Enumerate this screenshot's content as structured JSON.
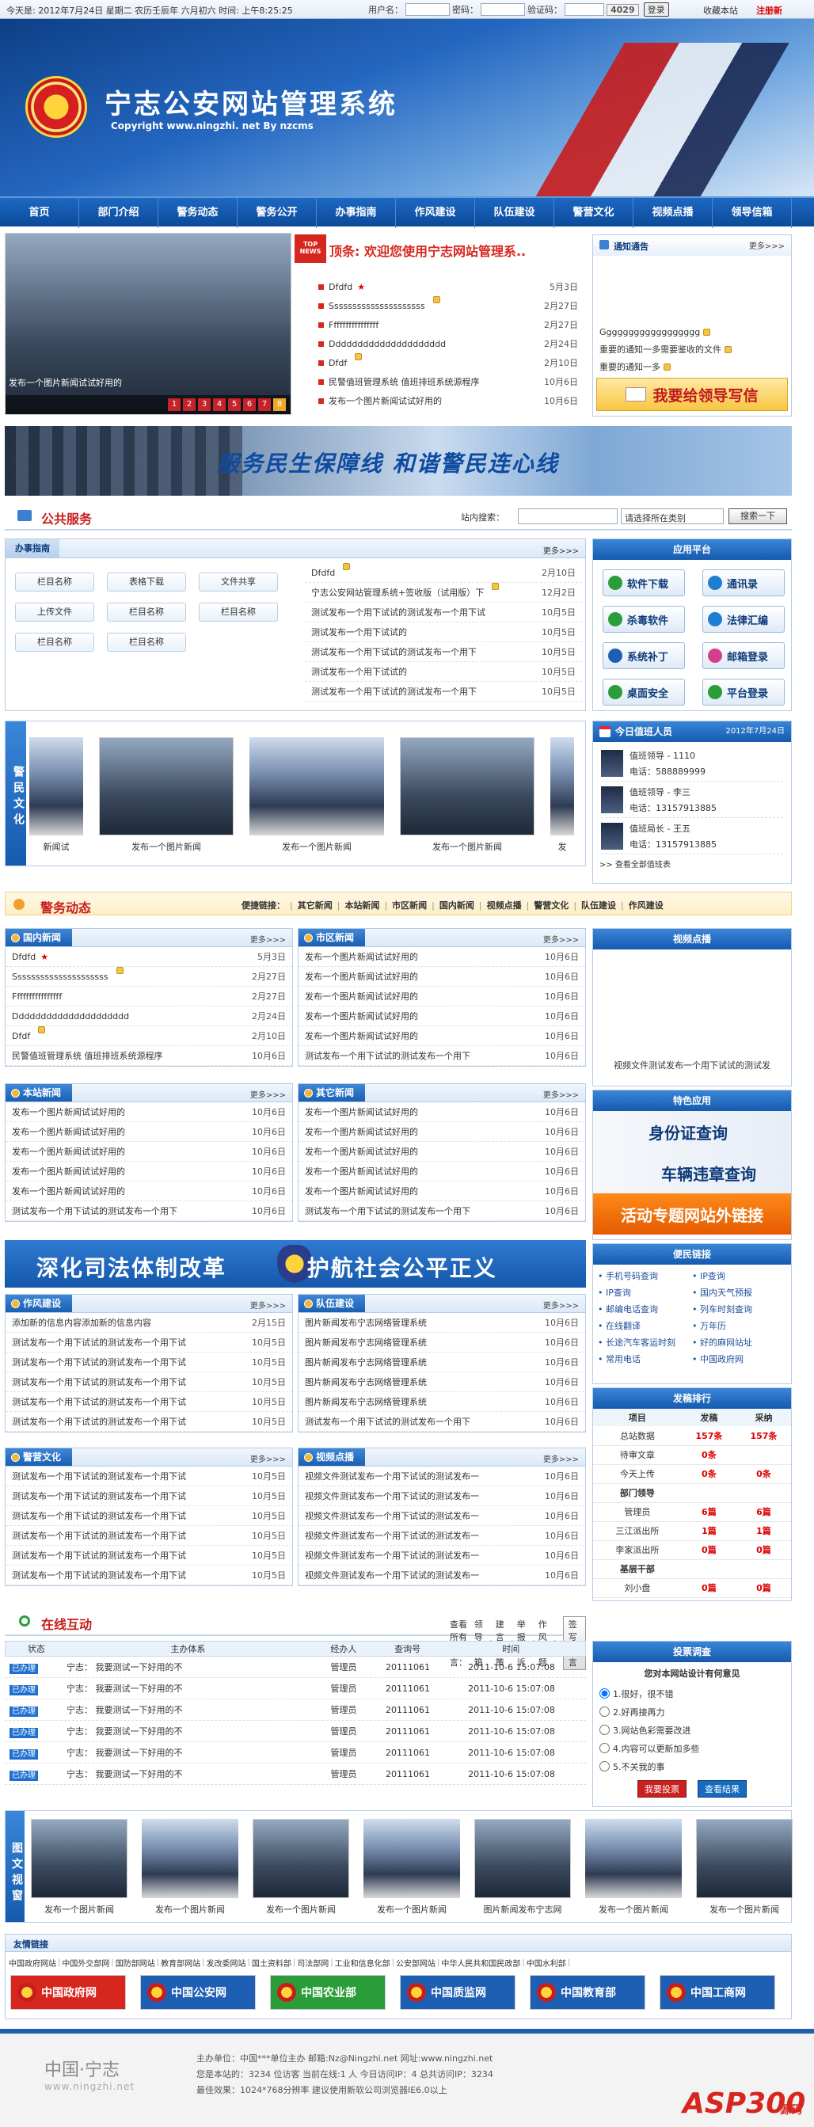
{
  "topbar": {
    "calendar": "今天是: 2012年7月24日 星期二  农历壬辰年 六月初六 时间: 上午8:25:25",
    "user_label": "用户名：",
    "pass_label": "密码：",
    "code_label": "验证码：",
    "code": "4029",
    "login_btn": "登录",
    "fav": "收藏本站",
    "reg": "注册新"
  },
  "header": {
    "title": "宁志公安网站管理系统",
    "copyright": "Copyright  www.ningzhi. net By nzcms"
  },
  "nav": [
    "首页",
    "部门介绍",
    "警务动态",
    "警务公开",
    "办事指南",
    "作风建设",
    "队伍建设",
    "警营文化",
    "视频点播",
    "领导信箱"
  ],
  "slideshow": {
    "caption": "发布一个图片新闻试试好用的",
    "pages": [
      "1",
      "2",
      "3",
      "4",
      "5",
      "6",
      "7",
      "8"
    ]
  },
  "headline": {
    "badge": "TOP NEWS",
    "title": "顶条: 欢迎您使用宁志网站管理系..",
    "items": [
      {
        "t": "Dfdfd",
        "star": true,
        "d": "5月3日"
      },
      {
        "t": "Sssssssssssssssssssss",
        "lock": true,
        "d": "2月27日"
      },
      {
        "t": "Ffffffffffffffff",
        "d": "2月27日"
      },
      {
        "t": "Ddddddddddddddddddddd",
        "d": "2月24日"
      },
      {
        "t": "Dfdf",
        "lock": true,
        "d": "2月10日"
      },
      {
        "t": "民警值班管理系统 值班排班系统源程序",
        "d": "10月6日"
      },
      {
        "t": "发布一个图片新闻试试好用的",
        "d": "10月6日"
      }
    ]
  },
  "notice": {
    "title": "通知通告",
    "more": "更多>>>",
    "items": [
      {
        "t": "Gggggggggggggggggg",
        "lock": true
      },
      {
        "t": "重要的通知一多需要鉴收的文件",
        "lock": true
      },
      {
        "t": "重要的通知一多",
        "lock": true
      }
    ],
    "write": "我要给领导写信"
  },
  "banner1": "服务民生保障线   和谐警民连心线",
  "public": {
    "title": "公共服务",
    "search_label": "站内搜索：",
    "select": "请选择所在类别",
    "search_btn": "搜索一下",
    "guide_title": "办事指南",
    "guide_more": "更多>>>",
    "buttons": [
      "栏目名称",
      "表格下载",
      "文件共享",
      "上传文件",
      "栏目名称",
      "栏目名称",
      "栏目名称",
      "栏目名称"
    ],
    "items": [
      {
        "t": "Dfdfd",
        "lock": true,
        "d": "2月10日"
      },
      {
        "t": "宁志公安网站管理系统+签收版（试用版）下",
        "lock": true,
        "d": "12月2日"
      },
      {
        "t": "测试发布一个用下试试的测试发布一个用下试",
        "d": "10月5日"
      },
      {
        "t": "测试发布一个用下试试的",
        "d": "10月5日"
      },
      {
        "t": "测试发布一个用下试试的测试发布一个用下",
        "d": "10月5日"
      },
      {
        "t": "测试发布一个用下试试的",
        "d": "10月5日"
      },
      {
        "t": "测试发布一个用下试试的测试发布一个用下",
        "d": "10月5日"
      }
    ]
  },
  "platform": {
    "title": "应用平台",
    "items": [
      "软件下载",
      "通讯录",
      "杀毒软件",
      "法律汇编",
      "系统补丁",
      "邮箱登录",
      "桌面安全",
      "平台登录"
    ]
  },
  "culture": {
    "label": "警民文化",
    "caps": [
      "新闻试",
      "发布一个图片新闻",
      "发布一个图片新闻",
      "发布一个图片新闻",
      "发"
    ]
  },
  "duty": {
    "title": "今日值班人员",
    "date": "2012年7月24日",
    "people": [
      {
        "role": "值班领导 - 1110",
        "tel": "电话：588889999"
      },
      {
        "role": "值班领导 - 李三",
        "tel": "电话：13157913885"
      },
      {
        "role": "值班局长 - 王五",
        "tel": "电话：13157913885"
      }
    ],
    "more": ">> 查看全部值班表"
  },
  "police": {
    "title": "警务动态",
    "quick": "便捷链接：",
    "links": [
      "其它新闻",
      "本站新闻",
      "市区新闻",
      "国内新闻",
      "视频点播",
      "警营文化",
      "队伍建设",
      "作风建设"
    ]
  },
  "domestic": {
    "title": "国内新闻",
    "more": "更多>>>",
    "items": [
      {
        "t": "Dfdfd",
        "star": true,
        "d": "5月3日"
      },
      {
        "t": "Sssssssssssssssssssss",
        "lock": true,
        "d": "2月27日"
      },
      {
        "t": "Ffffffffffffffff",
        "d": "2月27日"
      },
      {
        "t": "Ddddddddddddddddddddd",
        "d": "2月24日"
      },
      {
        "t": "Dfdf",
        "lock": true,
        "d": "2月10日"
      },
      {
        "t": "民警值班管理系统 值班排班系统源程序",
        "d": "10月6日"
      }
    ]
  },
  "city": {
    "title": "市区新闻",
    "more": "更多>>>",
    "items": [
      {
        "t": "发布一个图片新闻试试好用的",
        "d": "10月6日"
      },
      {
        "t": "发布一个图片新闻试试好用的",
        "d": "10月6日"
      },
      {
        "t": "发布一个图片新闻试试好用的",
        "d": "10月6日"
      },
      {
        "t": "发布一个图片新闻试试好用的",
        "d": "10月6日"
      },
      {
        "t": "发布一个图片新闻试试好用的",
        "d": "10月6日"
      },
      {
        "t": "测试发布一个用下试试的测试发布一个用下",
        "d": "10月6日"
      }
    ]
  },
  "site": {
    "title": "本站新闻",
    "more": "更多>>>",
    "items": [
      {
        "t": "发布一个图片新闻试试好用的",
        "d": "10月6日"
      },
      {
        "t": "发布一个图片新闻试试好用的",
        "d": "10月6日"
      },
      {
        "t": "发布一个图片新闻试试好用的",
        "d": "10月6日"
      },
      {
        "t": "发布一个图片新闻试试好用的",
        "d": "10月6日"
      },
      {
        "t": "发布一个图片新闻试试好用的",
        "d": "10月6日"
      },
      {
        "t": "测试发布一个用下试试的测试发布一个用下",
        "d": "10月6日"
      }
    ]
  },
  "other": {
    "title": "其它新闻",
    "more": "更多>>>",
    "items": [
      {
        "t": "发布一个图片新闻试试好用的",
        "d": "10月6日"
      },
      {
        "t": "发布一个图片新闻试试好用的",
        "d": "10月6日"
      },
      {
        "t": "发布一个图片新闻试试好用的",
        "d": "10月6日"
      },
      {
        "t": "发布一个图片新闻试试好用的",
        "d": "10月6日"
      },
      {
        "t": "发布一个图片新闻试试好用的",
        "d": "10月6日"
      },
      {
        "t": "测试发布一个用下试试的测试发布一个用下",
        "d": "10月6日"
      }
    ]
  },
  "video": {
    "title": "视频点播",
    "caption": "视频文件测试发布一个用下试试的测试发"
  },
  "special": {
    "title": "特色应用",
    "id": "身份证查询",
    "car": "车辆违章查询",
    "topic": "活动专题网站外链接"
  },
  "banner2": "深化司法体制改革   护航社会公平正义",
  "service": {
    "title": "便民链接",
    "links": [
      "手机号码查询",
      "IP查询",
      "IP查询",
      "国内天气预报",
      "邮编电话查询",
      "列车时刻查询",
      "在线翻译",
      "万年历",
      "长途汽车客运时刻",
      "好的麻网站址",
      "常用电话",
      "中国政府网"
    ]
  },
  "style": {
    "title": "作风建设",
    "more": "更多>>>",
    "items": [
      {
        "t": "添加新的信息内容添加新的信息内容",
        "d": "2月15日"
      },
      {
        "t": "测试发布一个用下试试的测试发布一个用下试",
        "d": "10月5日"
      },
      {
        "t": "测试发布一个用下试试的测试发布一个用下试",
        "d": "10月5日"
      },
      {
        "t": "测试发布一个用下试试的测试发布一个用下试",
        "d": "10月5日"
      },
      {
        "t": "测试发布一个用下试试的测试发布一个用下试",
        "d": "10月5日"
      },
      {
        "t": "测试发布一个用下试试的测试发布一个用下试",
        "d": "10月5日"
      }
    ]
  },
  "team": {
    "title": "队伍建设",
    "more": "更多>>>",
    "items": [
      {
        "t": "图片新闻发布宁志网络管理系统",
        "d": "10月6日"
      },
      {
        "t": "图片新闻发布宁志网络管理系统",
        "d": "10月6日"
      },
      {
        "t": "图片新闻发布宁志网络管理系统",
        "d": "10月6日"
      },
      {
        "t": "图片新闻发布宁志网络管理系统",
        "d": "10月6日"
      },
      {
        "t": "图片新闻发布宁志网络管理系统",
        "d": "10月6日"
      },
      {
        "t": "测试发布一个用下试试的测试发布一个用下",
        "d": "10月6日"
      }
    ]
  },
  "rank": {
    "title": "发稿排行",
    "head": [
      "项目",
      "发稿",
      "采纳"
    ],
    "rows": [
      {
        "a": "总站数据",
        "b": "157条",
        "c": "157条"
      },
      {
        "a": "待审文章",
        "b": "0条",
        "c": ""
      },
      {
        "a": "今天上传",
        "b": "0条",
        "c": "0条"
      },
      {
        "a": "部门领导",
        "b": "",
        "c": ""
      },
      {
        "a": "管理员",
        "b": "6篇",
        "c": "6篇"
      },
      {
        "a": "三江派出所",
        "b": "1篇",
        "c": "1篇"
      },
      {
        "a": "李家派出所",
        "b": "0篇",
        "c": "0篇"
      },
      {
        "a": "基层干部",
        "b": "",
        "c": ""
      },
      {
        "a": "刘小盘",
        "b": "0篇",
        "c": "0篇"
      }
    ]
  },
  "culture2": {
    "title": "警营文化",
    "more": "更多>>>",
    "items": [
      {
        "t": "测试发布一个用下试试的测试发布一个用下试",
        "d": "10月5日"
      },
      {
        "t": "测试发布一个用下试试的测试发布一个用下试",
        "d": "10月5日"
      },
      {
        "t": "测试发布一个用下试试的测试发布一个用下试",
        "d": "10月5日"
      },
      {
        "t": "测试发布一个用下试试的测试发布一个用下试",
        "d": "10月5日"
      },
      {
        "t": "测试发布一个用下试试的测试发布一个用下试",
        "d": "10月5日"
      },
      {
        "t": "测试发布一个用下试试的测试发布一个用下试",
        "d": "10月5日"
      }
    ]
  },
  "videos": {
    "title": "视频点播",
    "more": "更多>>>",
    "items": [
      {
        "t": "视频文件测试发布一个用下试试的测试发布一",
        "d": "10月6日"
      },
      {
        "t": "视频文件测试发布一个用下试试的测试发布一",
        "d": "10月6日"
      },
      {
        "t": "视频文件测试发布一个用下试试的测试发布一",
        "d": "10月6日"
      },
      {
        "t": "视频文件测试发布一个用下试试的测试发布一",
        "d": "10月6日"
      },
      {
        "t": "视频文件测试发布一个用下试试的测试发布一",
        "d": "10月6日"
      },
      {
        "t": "视频文件测试发布一个用下试试的测试发布一",
        "d": "10月6日"
      }
    ]
  },
  "interact": {
    "title": "在线互动",
    "view": "查看所有留言：",
    "links": [
      "领导信箱",
      "建言献策",
      "举报投诉",
      "作风问题"
    ],
    "post": "签写留言",
    "head": [
      "状态",
      "主办体系",
      "经办人",
      "查询号",
      "时间"
    ],
    "rows": [
      {
        "s": "已办理",
        "sys": "宁志：  我要测试一下好用的不",
        "p": "管理员",
        "n": "20111061",
        "t": "2011-10-6 15:07:08"
      },
      {
        "s": "已办理",
        "sys": "宁志：  我要测试一下好用的不",
        "p": "管理员",
        "n": "20111061",
        "t": "2011-10-6 15:07:08"
      },
      {
        "s": "已办理",
        "sys": "宁志：  我要测试一下好用的不",
        "p": "管理员",
        "n": "20111061",
        "t": "2011-10-6 15:07:08"
      },
      {
        "s": "已办理",
        "sys": "宁志：  我要测试一下好用的不",
        "p": "管理员",
        "n": "20111061",
        "t": "2011-10-6 15:07:08"
      },
      {
        "s": "已办理",
        "sys": "宁志：  我要测试一下好用的不",
        "p": "管理员",
        "n": "20111061",
        "t": "2011-10-6 15:07:08"
      },
      {
        "s": "已办理",
        "sys": "宁志：  我要测试一下好用的不",
        "p": "管理员",
        "n": "20111061",
        "t": "2011-10-6 15:07:08"
      }
    ]
  },
  "vote": {
    "title": "投票调查",
    "q": "您对本网站设计有何意见",
    "options": [
      "1.很好，很不错",
      "2.好再接再力",
      "3.网站色彩需要改进",
      "4.内容可以更新加多些",
      "5.不关我的事"
    ],
    "submit": "我要投票",
    "result": "查看结果"
  },
  "gallery": {
    "label": "图文视窗",
    "caps": [
      "发布一个图片新闻",
      "发布一个图片新闻",
      "发布一个图片新闻",
      "发布一个图片新闻",
      "图片新闻发布宁志网",
      "发布一个图片新闻",
      "发布一个图片新闻"
    ]
  },
  "friends": {
    "title": "友情链接",
    "text": [
      "中国政府网站",
      "中国外交部网",
      "国防部网站",
      "教育部网站",
      "发改委网站",
      "国土资料部",
      "司法部网",
      "工业和信息化部",
      "公安部网站",
      "中华人民共和国民政部",
      "中国水利部"
    ],
    "logos": [
      "中国政府网",
      "中国公安网",
      "中国农业部",
      "中国质监网",
      "中国教育部",
      "中国工商网"
    ]
  },
  "footer": {
    "brand": "中国·宁志",
    "brand_url": "www.ningzhi.net",
    "l1": "主办单位：中国***单位主办 邮箱:Nz@Ningzhi.net 网址:www.ningzhi.net",
    "l2": "您是本站的：3234 位访客  当前在线:1 人  今日访问IP：4  总共访问IP：3234",
    "l3": "最佳效果：1024*768分辨率 建议使用新软公司浏览器IE6.0以上",
    "badge": "ASP300",
    "badge2": "源码"
  }
}
